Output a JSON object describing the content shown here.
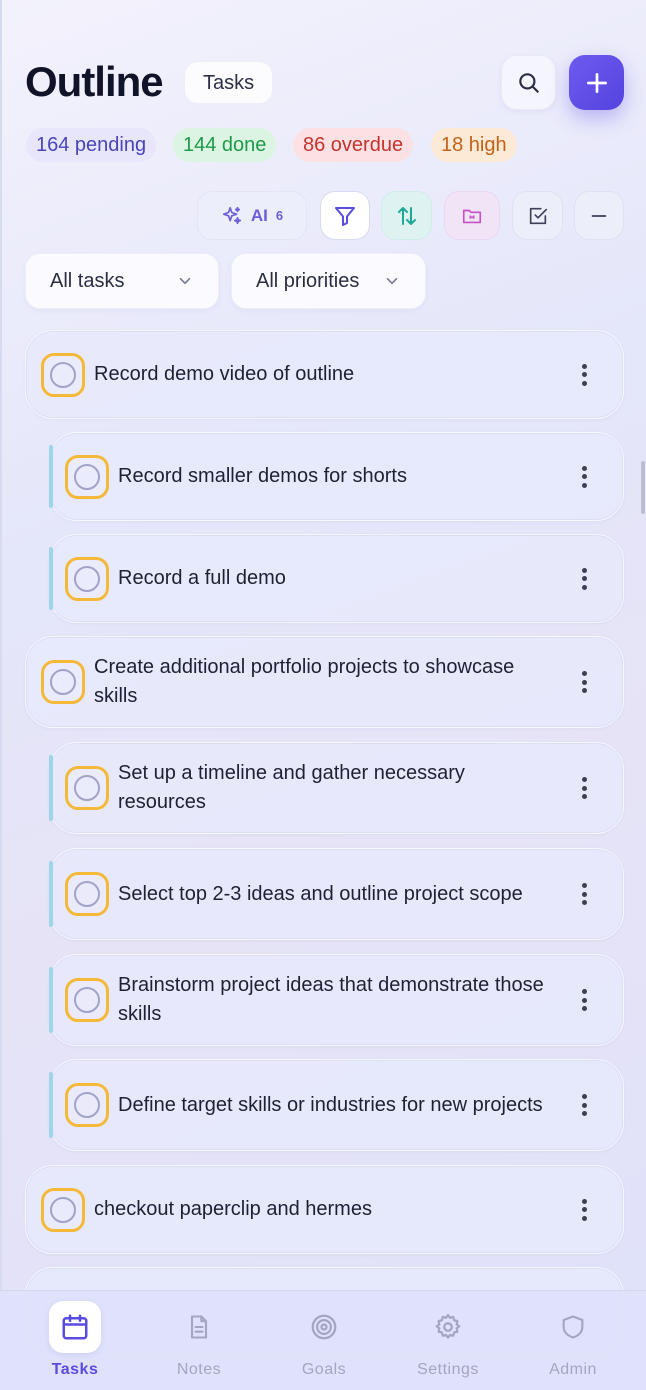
{
  "header": {
    "title": "Outline",
    "view_pill": "Tasks"
  },
  "stats": {
    "pending": "164 pending",
    "done": "144 done",
    "overdue": "86 overdue",
    "high": "18 high"
  },
  "toolbar": {
    "ai_label": "AI",
    "ai_count": "6",
    "icons": [
      "sparkle-icon",
      "filter-icon",
      "sort-icon",
      "folder-icon",
      "checkbox-icon",
      "minus-icon"
    ]
  },
  "filters": {
    "task_filter": "All tasks",
    "priority_filter": "All priorities"
  },
  "tasks": [
    {
      "text": "Record demo video of outline",
      "level": 0
    },
    {
      "text": "Record smaller demos for shorts",
      "level": 1
    },
    {
      "text": "Record a full demo",
      "level": 1
    },
    {
      "text": "Create additional portfolio projects to showcase skills",
      "level": 0
    },
    {
      "text": "Set up a timeline and gather necessary resources",
      "level": 1
    },
    {
      "text": "Select top 2-3 ideas and outline project scope",
      "level": 1
    },
    {
      "text": "Brainstorm project ideas that demonstrate those skills",
      "level": 1
    },
    {
      "text": "Define target skills or industries for new projects",
      "level": 1
    },
    {
      "text": "checkout paperclip and hermes",
      "level": 0
    }
  ],
  "nav": {
    "tasks": "Tasks",
    "notes": "Notes",
    "goals": "Goals",
    "settings": "Settings",
    "admin": "Admin",
    "active": "Tasks"
  },
  "colors": {
    "accent": "#5a4ce0",
    "checkbox_border": "#f5b93a",
    "subtask_bar": "#9fd5ea"
  }
}
